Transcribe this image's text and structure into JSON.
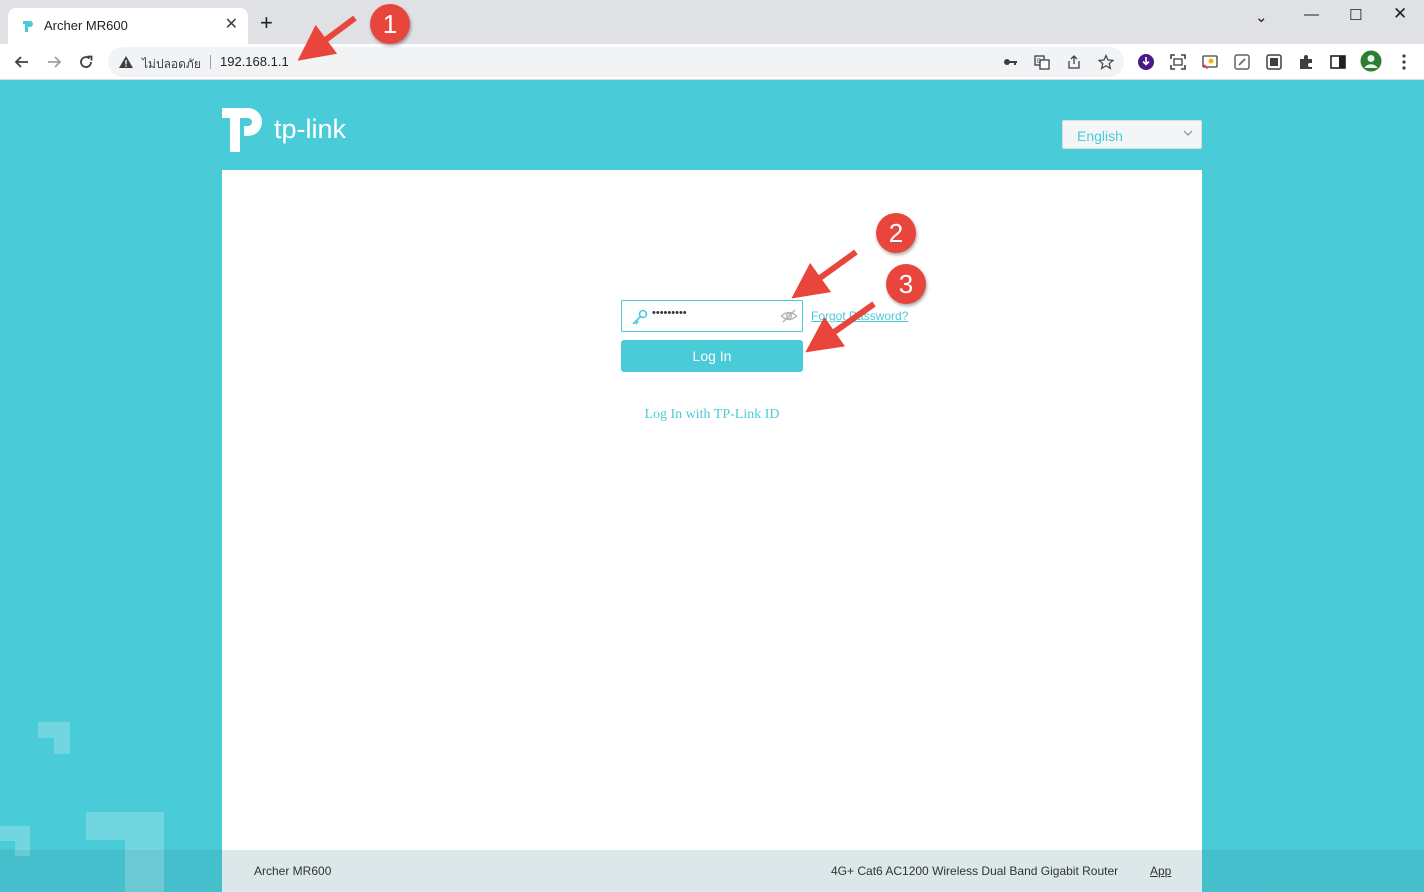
{
  "browser": {
    "tab_title": "Archer MR600",
    "tab_close": "✕",
    "new_tab": "+",
    "security_label": "ไม่ปลอดภัย",
    "url": "192.168.1.1",
    "window_controls": {
      "chevron": "⌄",
      "minimize": "—",
      "maximize": "☐",
      "close": "✕"
    },
    "icons": [
      "back-icon",
      "forward-icon",
      "reload-icon",
      "warning-icon",
      "key-icon",
      "translate-icon",
      "share-icon",
      "star-icon",
      "download-extension-icon",
      "screenshot-icon",
      "cast-icon",
      "edit-icon",
      "capture-icon",
      "puzzle-icon",
      "sidepanel-icon",
      "profile-avatar",
      "menu-icon"
    ]
  },
  "page": {
    "brand": "tp-link",
    "language": {
      "selected": "English"
    },
    "login": {
      "password_value": "•••••••••",
      "forgot_link": "Forgot Password?",
      "login_button": "Log In",
      "tplink_id_link": "Log In with TP-Link ID"
    },
    "footer": {
      "model": "Archer MR600",
      "description": "4G+ Cat6 AC1200 Wireless Dual Band Gigabit Router",
      "app_link": "App"
    }
  },
  "annotations": {
    "step1": "1",
    "step2": "2",
    "step3": "3"
  },
  "colors": {
    "brand_teal": "#4acbd8",
    "annotation_red": "#e8463d"
  }
}
